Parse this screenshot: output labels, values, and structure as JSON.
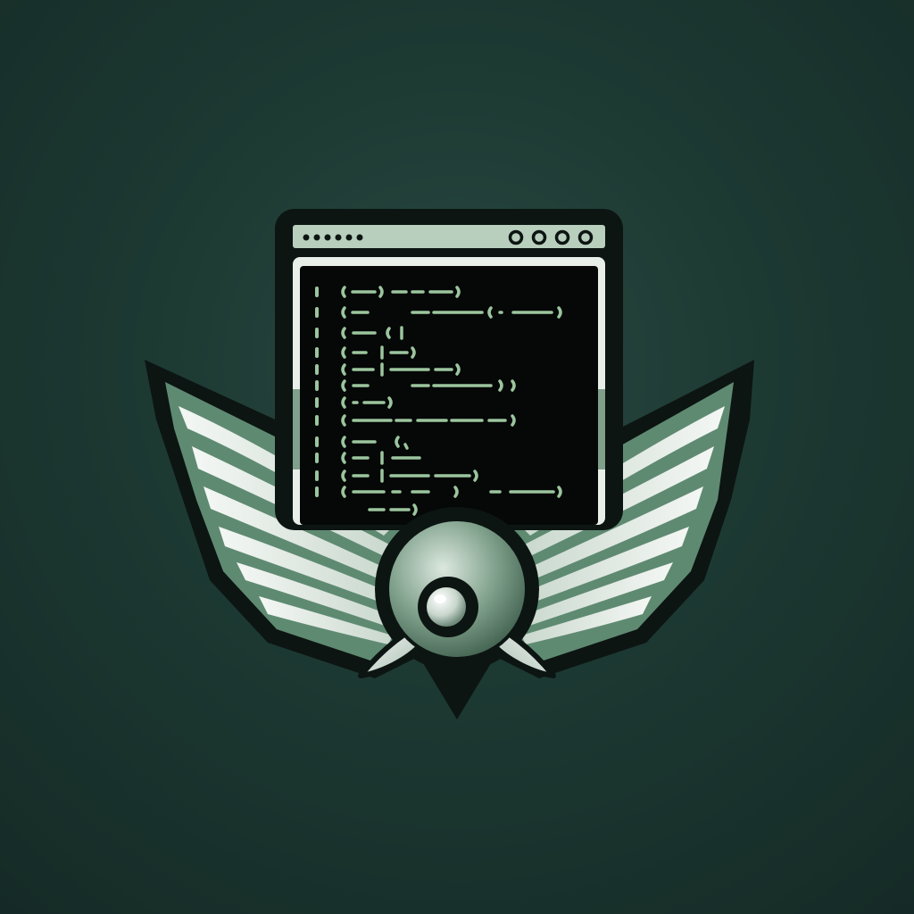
{
  "colors": {
    "background_center": "#2a4a42",
    "background_edge": "#152a26",
    "outline": "#0c1512",
    "sage": "#8fb39a",
    "sage_dark": "#5f8a72",
    "light": "#e8efe9",
    "code_text": "#9cc59e",
    "screen": "#050807"
  },
  "icons": {
    "window": "terminal-window-icon",
    "wings": "wings-icon",
    "emblem": "orb-emblem-icon"
  },
  "code_glyph_rows": 13
}
